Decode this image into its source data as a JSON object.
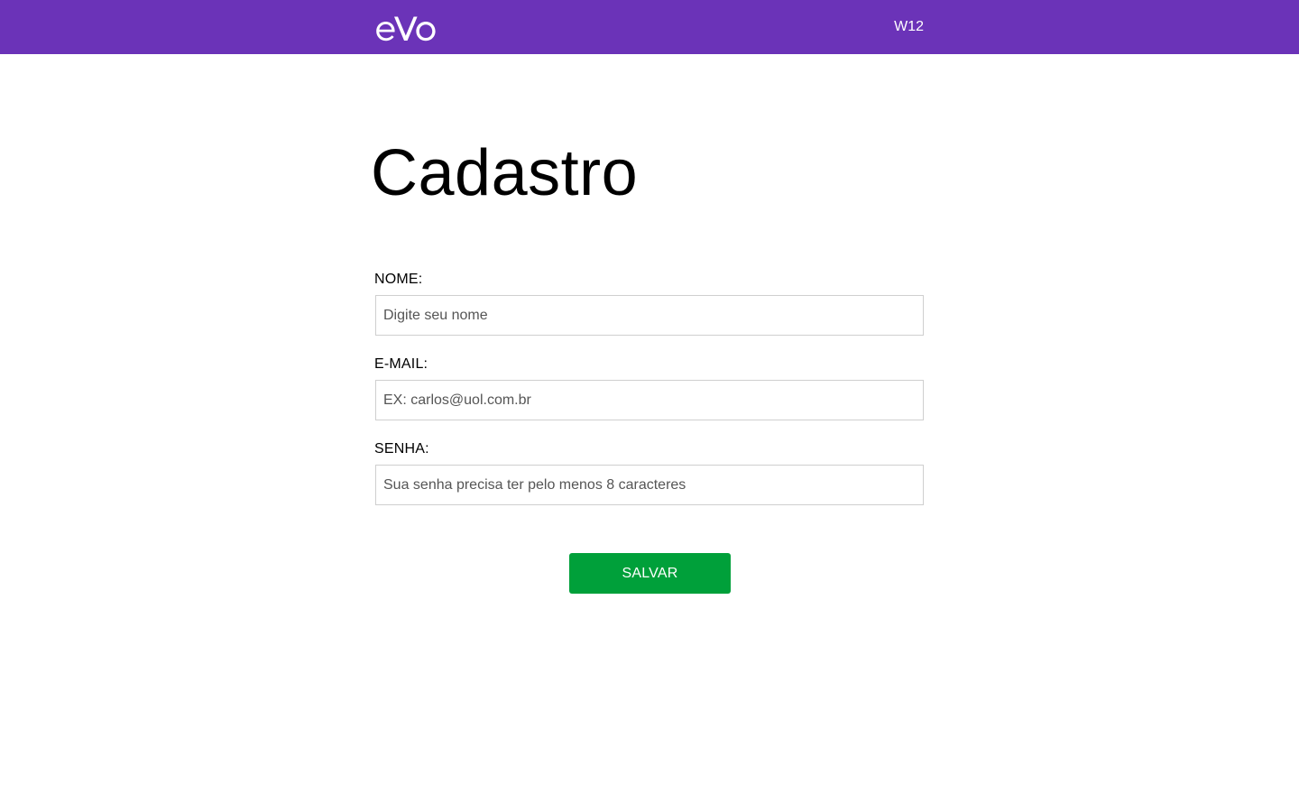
{
  "header": {
    "logo_text": "eVo",
    "brand_label": "W12",
    "background_color": "#6b33b8"
  },
  "form": {
    "title": "Cadastro",
    "fields": [
      {
        "label": "NOME:",
        "placeholder": "Digite seu nome",
        "value": ""
      },
      {
        "label": "E-MAIL:",
        "placeholder": "EX: carlos@uol.com.br",
        "value": ""
      },
      {
        "label": "SENHA:",
        "placeholder": "Sua senha precisa ter pelo menos 8 caracteres",
        "value": ""
      }
    ],
    "save_label": "SALVAR",
    "save_color": "#00a03a"
  }
}
